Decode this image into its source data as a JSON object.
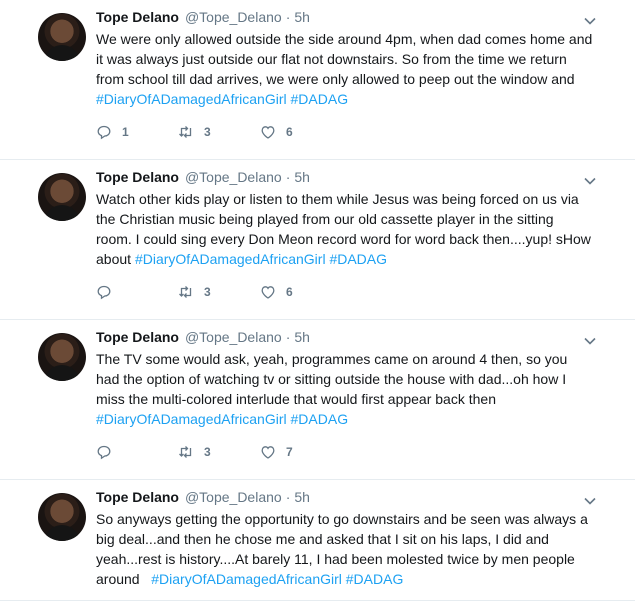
{
  "tweets": [
    {
      "name": "Tope Delano",
      "handle": "@Tope_Delano",
      "time": "5h",
      "text": "We were only allowed outside the side around 4pm, when dad comes home and it was always just outside our flat not downstairs. So from the time we return from school till dad arrives, we were only allowed to peep out the window and ",
      "hashtags": "#DiaryOfADamagedAfricanGirl #DADAG",
      "replies": "1",
      "retweets": "3",
      "likes": "6"
    },
    {
      "name": "Tope Delano",
      "handle": "@Tope_Delano",
      "time": "5h",
      "text": "Watch other kids play or listen to them while Jesus was being forced on us via the Christian music being played from our old cassette player in the sitting room. I could sing every Don Meon record word for word back then....yup! sHow about ",
      "hashtags": "#DiaryOfADamagedAfricanGirl #DADAG",
      "replies": "",
      "retweets": "3",
      "likes": "6"
    },
    {
      "name": "Tope Delano",
      "handle": "@Tope_Delano",
      "time": "5h",
      "text": "The TV some would ask, yeah, programmes came on around 4 then, so you had the option of watching tv or sitting outside the house with dad...oh how I miss the multi-colored interlude that would first appear back then ",
      "hashtags": "#DiaryOfADamagedAfricanGirl #DADAG",
      "replies": "",
      "retweets": "3",
      "likes": "7"
    },
    {
      "name": "Tope Delano",
      "handle": "@Tope_Delano",
      "time": "5h",
      "text": "So anyways getting the opportunity to go downstairs and be seen was always a big deal...and then he chose me and asked that I sit on his laps, I did and yeah...rest is history....At barely 11, I had been molested twice by men people around   ",
      "hashtags": "#DiaryOfADamagedAfricanGirl #DADAG",
      "replies": "",
      "retweets": "",
      "likes": ""
    }
  ],
  "icons": {
    "reply": "reply-icon",
    "retweet": "retweet-icon",
    "like": "heart-icon",
    "menu": "chevron-down-icon"
  },
  "colors": {
    "accent": "#1da1f2",
    "secondary_text": "#657786",
    "background": "#e6ecf0"
  }
}
